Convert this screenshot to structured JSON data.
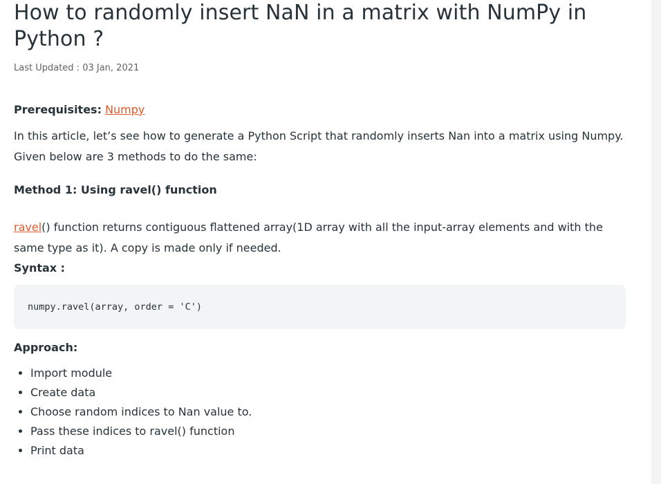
{
  "article": {
    "title": "How to randomly insert NaN in a matrix with NumPy in Python ?",
    "updated": "Last Updated : 03 Jan, 2021",
    "prereq_label": "Prerequisites:",
    "prereq_link": "Numpy",
    "intro": "In this article, let’s see how to generate a Python Script that randomly inserts Nan into a matrix using Numpy. Given below are 3 methods to do the same:",
    "method1_heading": "Method 1: Using ravel() function",
    "ravel_link": "ravel",
    "ravel_desc": "() function returns contiguous flattened array(1D array with all the input-array elements and with the same type as it). A copy is made only if needed.",
    "syntax_label": "Syntax :",
    "syntax_code": "numpy.ravel(array, order = 'C')",
    "approach_label": "Approach:",
    "approach_steps": [
      "Import module",
      "Create data",
      "Choose random indices to Nan value to.",
      "Pass these indices to ravel() function",
      "Print data"
    ]
  },
  "colors": {
    "link": "#e05a2b",
    "text": "#273239",
    "code_bg": "#f3f4f6"
  }
}
